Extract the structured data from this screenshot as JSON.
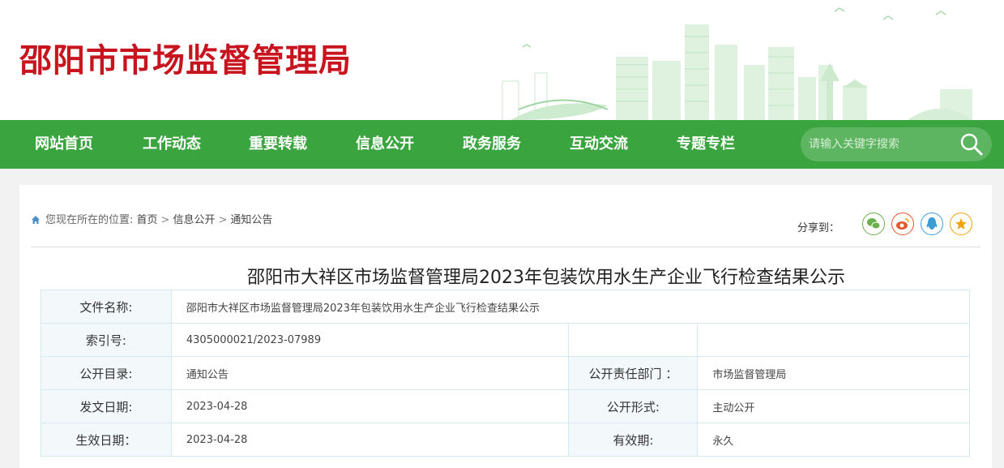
{
  "site": {
    "title": "邵阳市市场监督管理局"
  },
  "nav": {
    "items": [
      {
        "label": "网站首页"
      },
      {
        "label": "工作动态"
      },
      {
        "label": "重要转载"
      },
      {
        "label": "信息公开"
      },
      {
        "label": "政务服务"
      },
      {
        "label": "互动交流"
      },
      {
        "label": "专题专栏"
      }
    ],
    "search_placeholder": "请输入关键字搜索"
  },
  "breadcrumb": {
    "prefix": "您现在所在的位置:",
    "items": [
      "首页",
      "信息公开",
      "通知公告"
    ],
    "separator": ">"
  },
  "share": {
    "label": "分享到：",
    "buttons": [
      {
        "icon": "wechat-icon",
        "color": "#6ab04c"
      },
      {
        "icon": "weibo-icon",
        "color": "#e4572e"
      },
      {
        "icon": "qq-icon",
        "color": "#3d9bd6"
      },
      {
        "icon": "qzone-icon",
        "color": "#f0a30a"
      }
    ]
  },
  "article": {
    "title": "邵阳市大祥区市场监督管理局2023年包装饮用水生产企业飞行检查结果公示"
  },
  "info_table": {
    "file_name_label": "文件名称:",
    "file_name_value": "邵阳市大祥区市场监督管理局2023年包装饮用水生产企业飞行检查结果公示",
    "index_label": "索引号:",
    "index_value": "4305000021/2023-07989",
    "catalog_label": "公开目录:",
    "catalog_value": "通知公告",
    "dept_label": "公开责任部门 ：",
    "dept_value": "市场监督管理局",
    "issue_date_label": "发文日期:",
    "issue_date_value": "2023-04-28",
    "form_label": "公开形式:",
    "form_value": "主动公开",
    "effective_date_label": "生效日期：",
    "effective_date_value": "2023-04-28",
    "validity_label": "有效期:",
    "validity_value": "永久"
  },
  "colors": {
    "brand_red": "#c8141e",
    "nav_green": "#3aa53f"
  }
}
